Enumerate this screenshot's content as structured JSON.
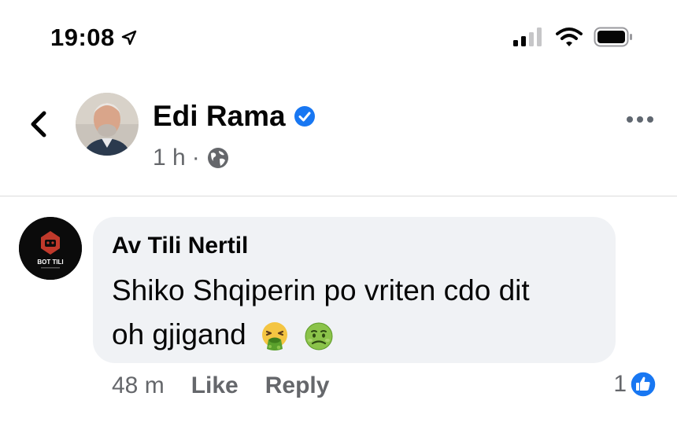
{
  "status_bar": {
    "time": "19:08",
    "location_icon": "location-arrow-icon",
    "signal_icon": "cellular-signal-icon",
    "wifi_icon": "wifi-icon",
    "battery_icon": "battery-icon"
  },
  "post_header": {
    "back_icon": "chevron-left-icon",
    "author_name": "Edi Rama",
    "verified_icon": "verified-badge-icon",
    "time_ago": "1 h",
    "separator": "·",
    "privacy_icon": "globe-icon",
    "more_icon": "more-dots-icon"
  },
  "comment": {
    "author": "Av Tili Nertil",
    "avatar_logo_text": "BOT TILI",
    "line1": "Shiko Shqiperin po vriten cdo dit",
    "line2": "oh gjigand",
    "emojis": [
      "face-vomiting-emoji",
      "nauseated-face-emoji"
    ],
    "time_ago": "48 m",
    "like_label": "Like",
    "reply_label": "Reply",
    "reaction_count": "1",
    "reaction_icon": "like-reaction-icon"
  },
  "colors": {
    "accent": "#1877f2",
    "bubble": "#f0f2f5",
    "secondary_text": "#65676b"
  }
}
